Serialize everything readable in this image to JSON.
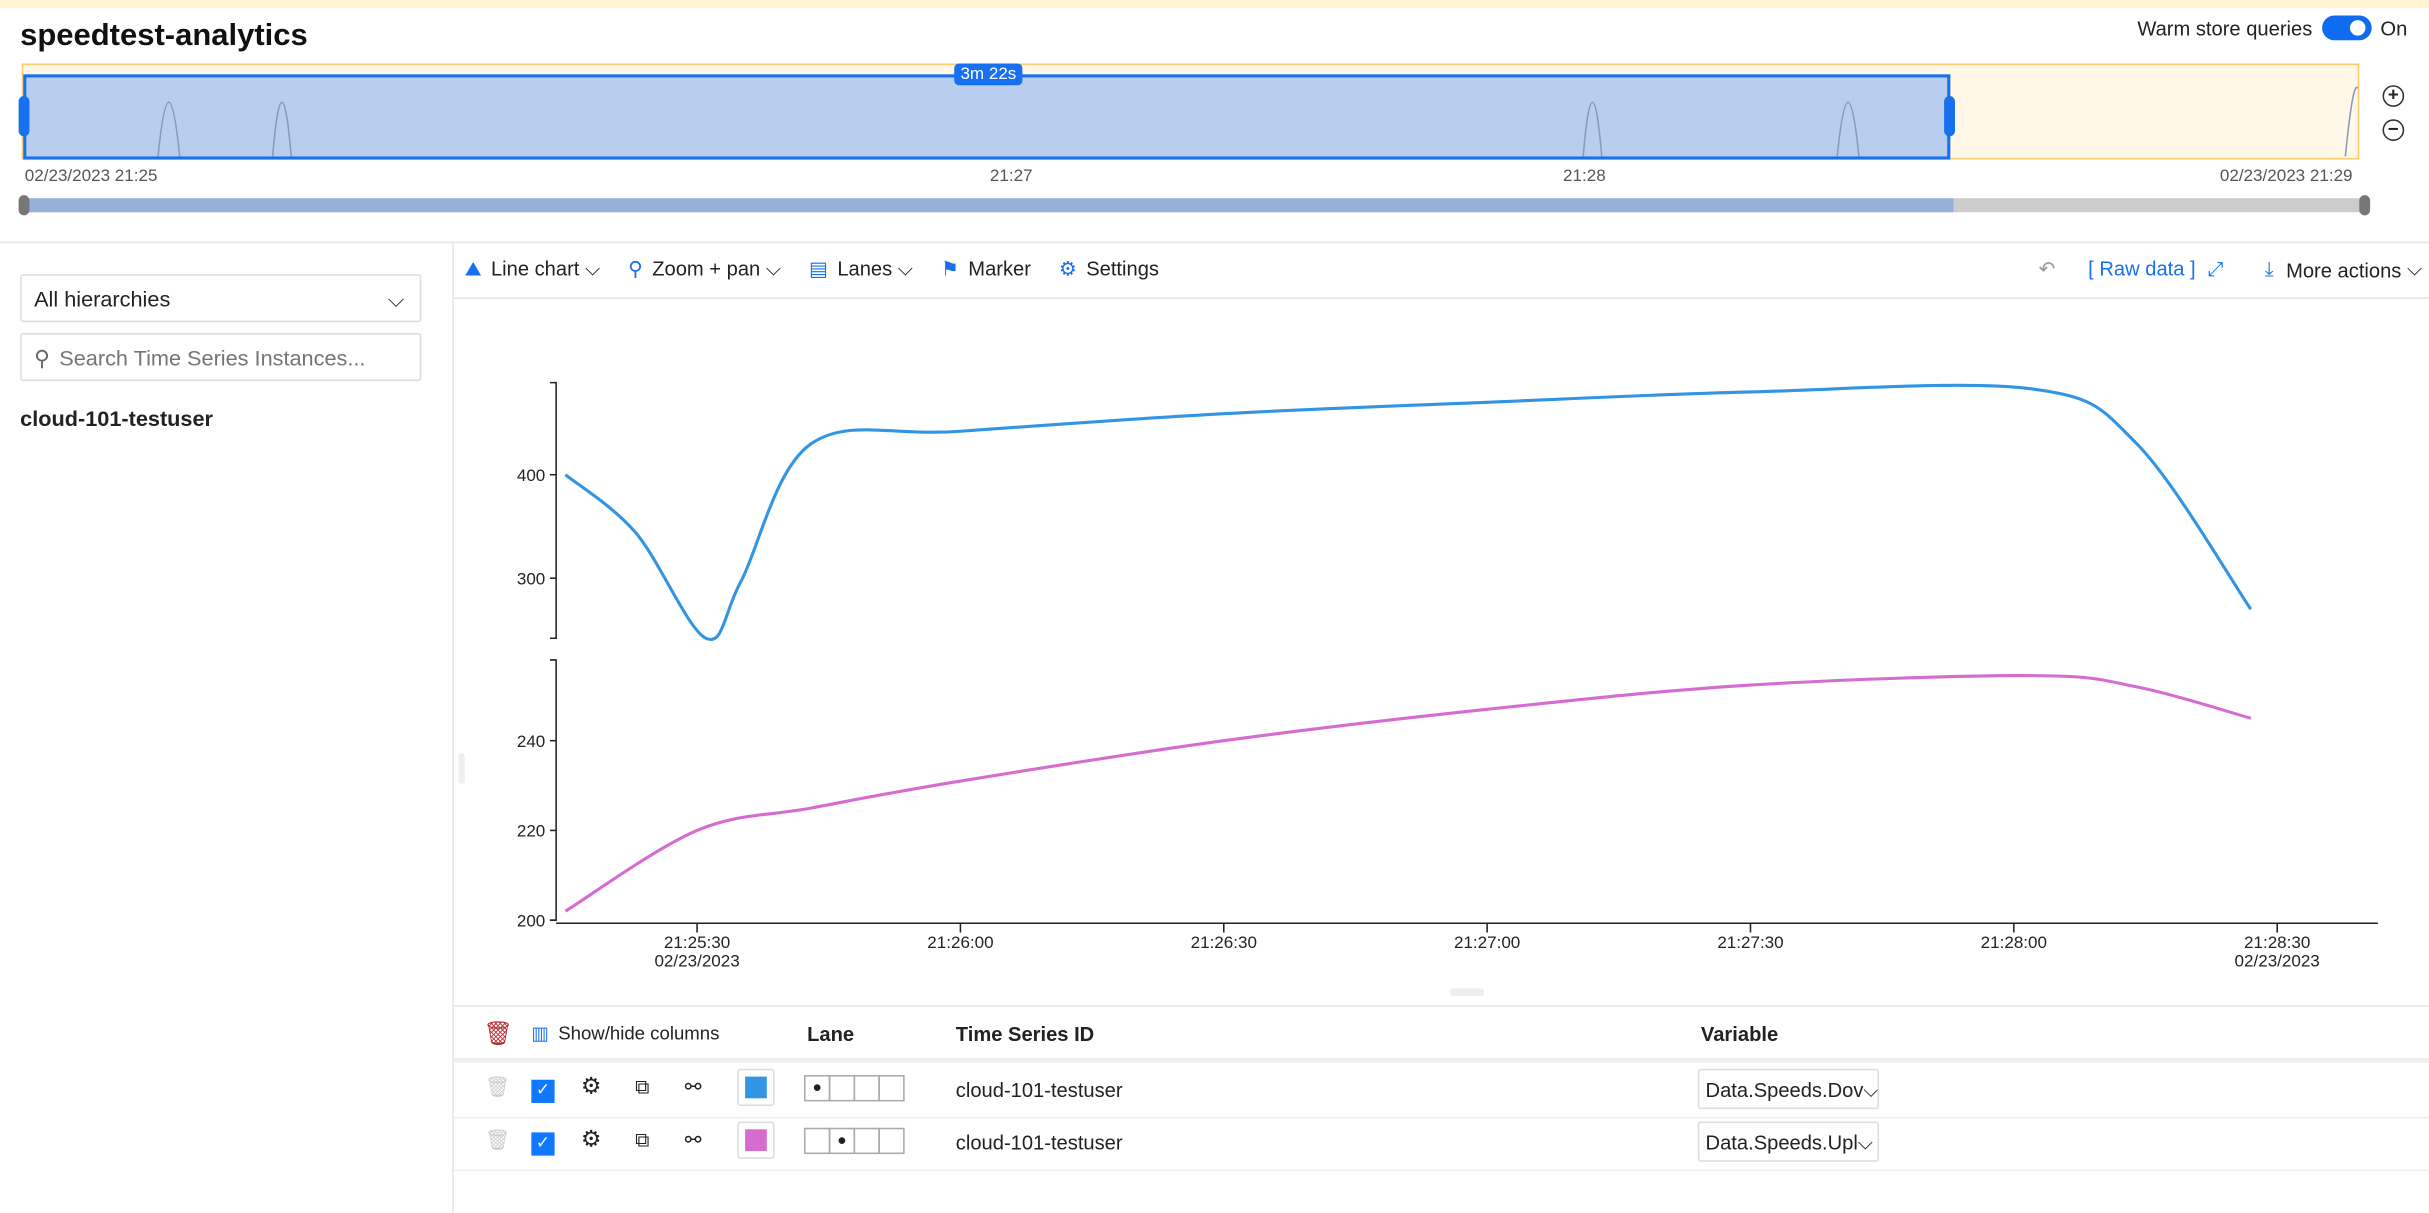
{
  "app": {
    "title": "speedtest-analytics",
    "warm_label": "Warm store queries",
    "warm_state": "On",
    "warm_on": true
  },
  "brush": {
    "duration": "3m 22s",
    "start_label": "02/23/2023 21:25",
    "t1": "21:27",
    "t2": "21:28",
    "end_label": "02/23/2023 21:29"
  },
  "sidebar": {
    "hierarchy": "All hierarchies",
    "search_placeholder": "Search Time Series Instances...",
    "tree_items": [
      "cloud-101-testuser"
    ]
  },
  "toolbar": {
    "line_chart": "Line chart",
    "zoom_pan": "Zoom + pan",
    "lanes": "Lanes",
    "marker": "Marker",
    "settings": "Settings",
    "raw_data": "[ Raw data ]",
    "more_actions": "More actions"
  },
  "table": {
    "show_hide": "Show/hide columns",
    "headers": {
      "lane": "Lane",
      "tsid": "Time Series ID",
      "variable": "Variable"
    },
    "rows": [
      {
        "tsid": "cloud-101-testuser",
        "variable": "Data.Speeds.Dov",
        "color": "#3195e4",
        "lane": 1
      },
      {
        "tsid": "cloud-101-testuser",
        "variable": "Data.Speeds.Upl",
        "color": "#d66bd0",
        "lane": 2
      }
    ]
  },
  "chart_data": {
    "type": "line",
    "x_ticks": [
      "21:25:30",
      "21:26:00",
      "21:26:30",
      "21:27:00",
      "21:27:30",
      "21:28:00",
      "21:28:30"
    ],
    "x_date": "02/23/2023",
    "lanes": [
      {
        "yticks": [
          300,
          400
        ],
        "ylim": [
          242,
          489
        ],
        "series": {
          "color": "#3195e4",
          "x": [
            "21:25:15",
            "21:25:23",
            "21:25:31",
            "21:25:35",
            "21:25:43",
            "21:26:00",
            "21:26:30",
            "21:27:00",
            "21:27:30",
            "21:28:02",
            "21:28:14",
            "21:28:27"
          ],
          "y": [
            400,
            344,
            242,
            297,
            430,
            442,
            459,
            470,
            480,
            483,
            430,
            270
          ]
        }
      },
      {
        "yticks": [
          200,
          220,
          240
        ],
        "ylim": [
          200,
          258
        ],
        "series": {
          "color": "#d66bd0",
          "x": [
            "21:25:15",
            "21:25:30",
            "21:25:43",
            "21:26:00",
            "21:26:30",
            "21:27:00",
            "21:27:30",
            "21:28:02",
            "21:28:14",
            "21:28:27"
          ],
          "y": [
            202,
            220,
            225,
            231,
            240,
            247,
            252.4,
            254.5,
            252,
            245
          ]
        }
      }
    ]
  }
}
